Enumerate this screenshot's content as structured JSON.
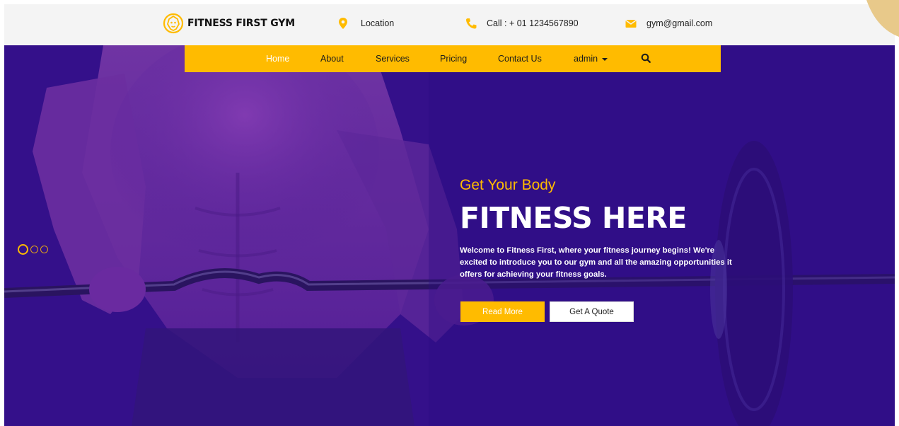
{
  "brand": {
    "name": "FITNESS FIRST GYM",
    "logo_icon": "lion-logo-icon"
  },
  "contact": {
    "location": {
      "icon": "map-pin-icon",
      "text": "Location"
    },
    "phone": {
      "icon": "phone-icon",
      "text": "Call : + 01 1234567890"
    },
    "email": {
      "icon": "envelope-icon",
      "text": "gym@gmail.com"
    }
  },
  "nav": {
    "items": [
      {
        "label": "Home",
        "active": true
      },
      {
        "label": "About"
      },
      {
        "label": "Services"
      },
      {
        "label": "Pricing"
      },
      {
        "label": "Contact Us"
      },
      {
        "label": "admin"
      }
    ],
    "search_icon": "search-icon"
  },
  "hero": {
    "tagline": "Get Your Body",
    "headline": "FITNESS HERE",
    "description": "Welcome to Fitness First, where your fitness journey begins! We're excited to introduce you to our gym and all the amazing opportunities it offers for achieving your fitness goals.",
    "primary_button": "Read More",
    "secondary_button": "Get A Quote",
    "slider_dots": {
      "count": 3,
      "active_index": 0
    }
  },
  "colors": {
    "accent": "#ffbb00",
    "hero_purple": "#35108a",
    "topbar": "#f4f4f4"
  }
}
